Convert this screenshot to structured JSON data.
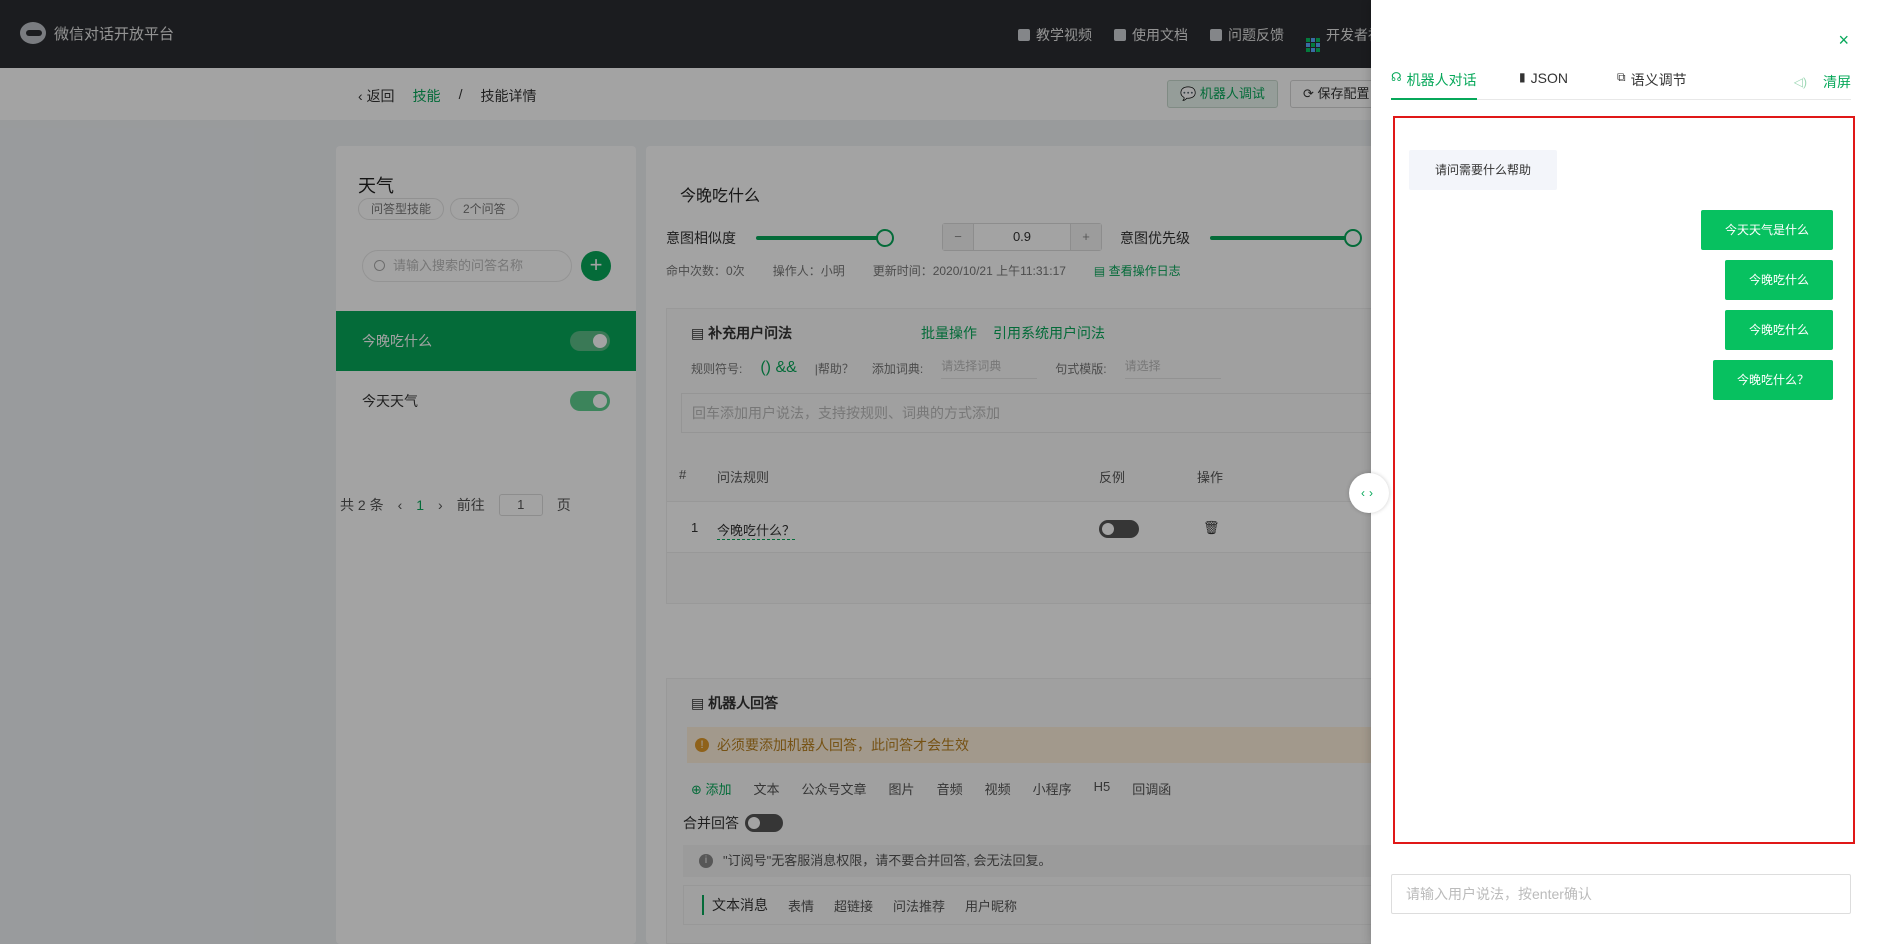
{
  "app": {
    "name": "微信对话开放平台"
  },
  "topnav": {
    "items": [
      "教学视频",
      "使用文档",
      "问题反馈",
      "开发者社"
    ]
  },
  "breadcrumb": {
    "back": "返回",
    "section": "技能",
    "sep": "/",
    "current": "技能详情"
  },
  "header_buttons": {
    "robot_debug": "机器人调试",
    "save_config": "保存配置"
  },
  "skill": {
    "title": "天气",
    "tag_type": "问答型技能",
    "tag_count": "2个问答",
    "search_placeholder": "请输入搜索的问答名称",
    "add": "+",
    "items": [
      {
        "label": "今晚吃什么",
        "enabled": true
      },
      {
        "label": "今天天气",
        "enabled": true
      }
    ],
    "pager": {
      "total": "共 2 条",
      "prev": "‹",
      "page": "1",
      "next": "›",
      "goto": "前往",
      "goto_value": "1",
      "page_unit": "页"
    }
  },
  "detail": {
    "title": "今晚吃什么",
    "similarity_label": "意图相似度",
    "similarity_value": 0.9,
    "stepper_minus": "−",
    "stepper_value": "0.9",
    "stepper_plus": "+",
    "priority_label": "意图优先级",
    "priority_value": 1.0,
    "meta": {
      "hits": "命中次数：0次",
      "operator": "操作人：小明",
      "updated": "更新时间：2020/10/21 上午11:31:17",
      "log_link": "查看操作日志"
    },
    "supplement": {
      "heading": "补充用户问法",
      "batch": "批量操作",
      "cite": "引用系统用户问法",
      "rule_label": "规则符号:",
      "rule_symbols": "() &&",
      "help": "|帮助？",
      "dict_label": "添加词典:",
      "dict_placeholder": "请选择词典",
      "pattern_label": "句式模版:",
      "pattern_placeholder": "请选择",
      "input_placeholder": "回车添加用户说法，支持按规则、词典的方式添加",
      "columns": {
        "index": "#",
        "rule": "问法规则",
        "negative": "反例",
        "action": "操作"
      },
      "rows": [
        {
          "index": "1",
          "rule": "今晚吃什么？",
          "negative": false,
          "delete": "🗑"
        }
      ]
    },
    "reply": {
      "heading": "机器人回答",
      "warning": "必须要添加机器人回答，此问答才会生效",
      "tools": [
        "⊕ 添加",
        "文本",
        "公众号文章",
        "图片",
        "音频",
        "视频",
        "小程序",
        "H5",
        "回调函"
      ],
      "merge_label": "合并回答",
      "info": "\"订阅号\"无客服消息权限，请不要合并回答, 会无法回复。",
      "msg_tabs": [
        "文本消息",
        "表情",
        "超链接",
        "问法推荐",
        "用户昵称"
      ]
    }
  },
  "drawer": {
    "close": "×",
    "tabs": [
      {
        "icon": "headset-icon",
        "glyph": "☊",
        "label": "机器人对话"
      },
      {
        "icon": "bar-chart-icon",
        "glyph": "▮",
        "label": "JSON"
      },
      {
        "icon": "tune-icon",
        "glyph": "⧉",
        "label": "语义调节"
      }
    ],
    "clear": "清屏",
    "speaker_glyph": "◁)",
    "bot_message": "请问需要什么帮助",
    "user_messages": [
      "今天天气是什么",
      "今晚吃什么",
      "今晚吃什么",
      "今晚吃什么？"
    ],
    "input_placeholder": "请输入用户说法，按enter确认",
    "handle": "‹›"
  },
  "colors": {
    "accent": "#07a85a",
    "chat_bubble": "#07c160",
    "highlight_border": "#e01818"
  }
}
